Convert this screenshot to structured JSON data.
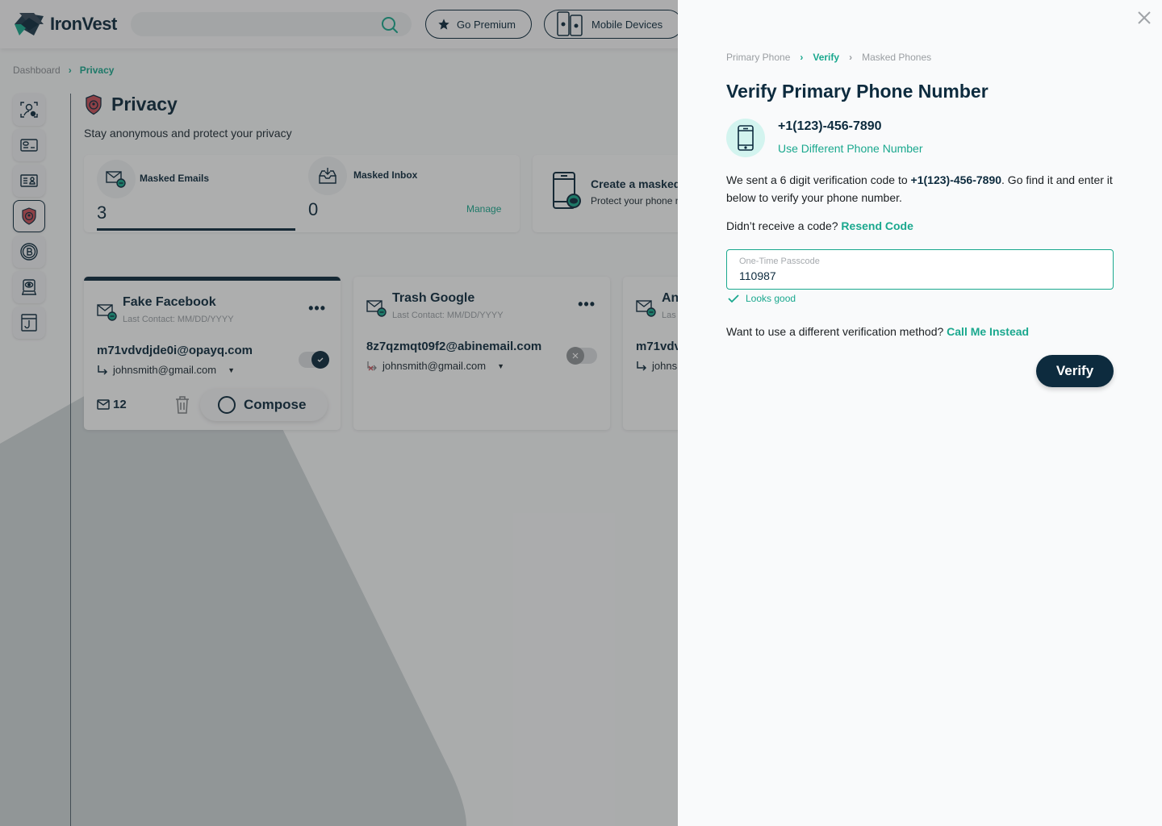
{
  "app": {
    "brand": "IronVest",
    "search_placeholder": "",
    "go_premium_label": "Go Premium",
    "mobile_devices_label": "Mobile Devices"
  },
  "breadcrumb": {
    "items": [
      "Dashboard",
      "Privacy"
    ]
  },
  "sidenav": {
    "items": [
      {
        "icon": "biometric-user-icon",
        "active": false
      },
      {
        "icon": "credit-card-icon",
        "active": false
      },
      {
        "icon": "id-card-icon",
        "active": false
      },
      {
        "icon": "privacy-shield-icon",
        "active": true
      },
      {
        "icon": "bitcoin-icon",
        "active": false
      },
      {
        "icon": "monitor-eye-icon",
        "active": false
      },
      {
        "icon": "phishing-hook-icon",
        "active": false
      }
    ]
  },
  "page": {
    "title": "Privacy",
    "subtitle": "Stay anonymous and protect your privacy"
  },
  "stats": {
    "masked_emails_label": "Masked Emails",
    "masked_emails_value": "3",
    "masked_inbox_label": "Masked Inbox",
    "masked_inbox_value": "0",
    "manage_label": "Manage"
  },
  "create_card": {
    "title": "Create a masked phone",
    "subtitle": "Protect your phone number"
  },
  "email_cards": [
    {
      "title": "Fake Facebook",
      "last_contact": "Last Contact: MM/DD/YYYY",
      "masked_email": "m71vdvdjde0i@opayq.com",
      "forward_to": "johnsmith@gmail.com",
      "enabled": true,
      "message_count": "12",
      "compose_label": "Compose"
    },
    {
      "title": "Trash Google",
      "last_contact": "Last Contact: MM/DD/YYYY",
      "masked_email": "8z7qzmqt09f2@abinemail.com",
      "forward_to": "johnsmith@gmail.com",
      "enabled": false
    },
    {
      "title": "An",
      "last_contact": "Las",
      "masked_email": "m71vdv",
      "forward_to": "johns",
      "enabled": true
    }
  ],
  "panel": {
    "breadcrumb": [
      "Primary Phone",
      "Verify",
      "Masked Phones"
    ],
    "title": "Verify Primary Phone Number",
    "phone_number": "+1(123)-456-7890",
    "use_different_label": "Use Different Phone Number",
    "message_before": "We sent a 6 digit verification code to ",
    "message_phone": "+1(123)-456-7890",
    "message_after": ". Go find it and enter it below to verify your phone number.",
    "resend_prompt": "Didn’t receive a code? ",
    "resend_label": "Resend Code",
    "otp_label": "One-Time Passcode",
    "otp_value": "110987",
    "validation_message": "Looks good",
    "alt_prompt": "Want to use a different verification method? ",
    "call_me_label": "Call Me Instead",
    "verify_label": "Verify"
  },
  "colors": {
    "brand_dark": "#0d2b3e",
    "accent_teal": "#1aa88e",
    "phone_circle_bg": "#d3f4ef",
    "alert_red": "#c9505a"
  }
}
